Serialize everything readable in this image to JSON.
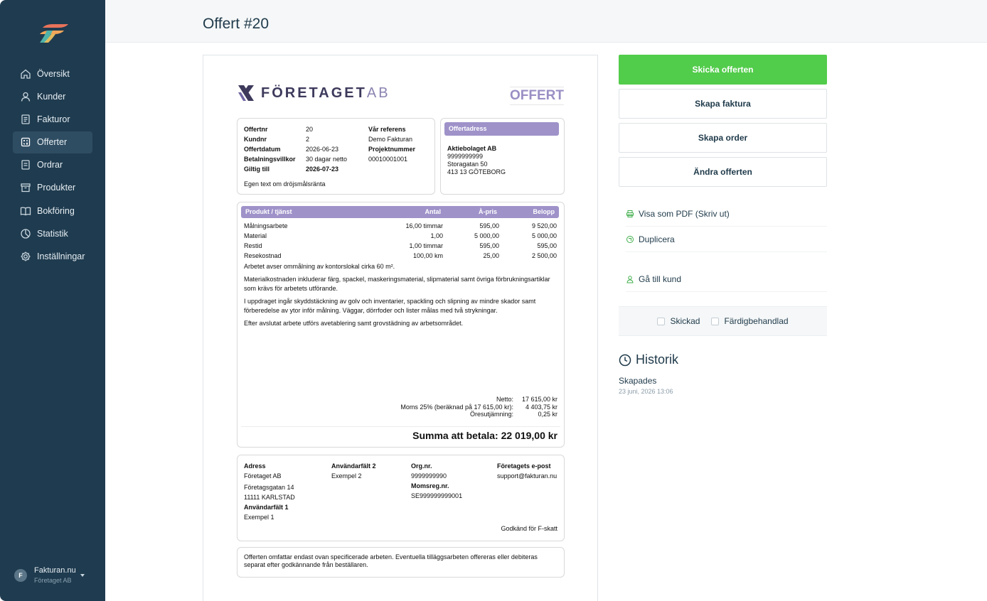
{
  "sidebar": {
    "items": [
      {
        "label": "Översikt",
        "icon": "home-icon"
      },
      {
        "label": "Kunder",
        "icon": "user-icon"
      },
      {
        "label": "Fakturor",
        "icon": "invoice-icon"
      },
      {
        "label": "Offerter",
        "icon": "calculator-icon",
        "active": true
      },
      {
        "label": "Ordrar",
        "icon": "order-icon"
      },
      {
        "label": "Produkter",
        "icon": "archive-box-icon"
      },
      {
        "label": "Bokföring",
        "icon": "book-icon"
      },
      {
        "label": "Statistik",
        "icon": "pie-chart-icon"
      },
      {
        "label": "Inställningar",
        "icon": "gear-icon"
      }
    ],
    "account": {
      "initial": "F",
      "name": "Fakturan.nu",
      "company": "Företaget AB"
    }
  },
  "header": {
    "title": "Offert #20"
  },
  "document": {
    "brand": {
      "name": "FÖRETAGET",
      "suffix": "AB"
    },
    "doc_type": "OFFERT",
    "info": {
      "rows": [
        [
          "Offertnr",
          "20",
          "Vår referens"
        ],
        [
          "Kundnr",
          "2",
          "Demo Fakturan"
        ],
        [
          "Offertdatum",
          "2026-06-23",
          "Projektnummer"
        ],
        [
          "Betalningsvillkor",
          "30 dagar netto",
          "00010001001"
        ],
        [
          "Giltig till",
          "2026-07-23",
          ""
        ]
      ],
      "custom_text": "Egen text om dröjsmålsränta"
    },
    "address": {
      "heading": "Offertadress",
      "company": "Aktiebolaget AB",
      "number": "9999999999",
      "street": "Storagatan 50",
      "city": "413 13 GÖTEBORG"
    },
    "lines": {
      "headers": {
        "product": "Produkt / tjänst",
        "qty": "Antal",
        "price": "À-pris",
        "amount": "Belopp"
      },
      "rows": [
        {
          "name": "Målningsarbete",
          "qty": "16,00 timmar",
          "price": "595,00",
          "amount": "9 520,00"
        },
        {
          "name": "Material",
          "qty": "1,00",
          "price": "5 000,00",
          "amount": "5 000,00"
        },
        {
          "name": "Restid",
          "qty": "1,00 timmar",
          "price": "595,00",
          "amount": "595,00"
        },
        {
          "name": "Resekostnad",
          "qty": "100,00 km",
          "price": "25,00",
          "amount": "2 500,00"
        }
      ],
      "paragraphs": [
        "Arbetet avser ommålning av kontorslokal cirka 60 m².",
        "Materialkostnaden inkluderar färg, spackel, maskeringsmaterial, slipmaterial samt övriga förbrukningsartiklar som krävs för arbetets utförande.",
        "I uppdraget ingår skyddstäckning av golv och inventarier, spackling och slipning av mindre skador samt förberedelse av ytor inför målning. Väggar, dörrfoder och lister målas med två strykningar.",
        "Efter avslutat arbete utförs avetablering samt grovstädning av arbetsområdet."
      ],
      "totals": [
        {
          "label": "Netto:",
          "value": "17 615,00 kr"
        },
        {
          "label": "Moms 25% (beräknad på 17 615,00 kr):",
          "value": "4 403,75 kr"
        },
        {
          "label": "Öresutjämning:",
          "value": "0,25 kr"
        }
      ],
      "sum_label": "Summa att betala: 22 019,00 kr"
    },
    "footer": {
      "col1": {
        "h": "Adress",
        "l1": "Företaget AB",
        "l2": "Företagsgatan 14",
        "l3": "11111 KARLSTAD",
        "h2": "Användarfält 1",
        "l4": "Exempel 1"
      },
      "col2": {
        "h": "Användarfält 2",
        "l1": "Exempel 2"
      },
      "col3": {
        "h": "Org.nr.",
        "l1": "9999999990",
        "h2": "Momsreg.nr.",
        "l2": "SE999999999001"
      },
      "col4": {
        "h": "Företagets e-post",
        "l1": "support@fakturan.nu"
      },
      "fskatt": "Godkänd för F-skatt"
    },
    "note": "Offerten omfattar endast ovan specificerade arbeten. Eventuella tilläggsarbeten offereras eller debiteras separat efter godkännande från beställaren."
  },
  "actions": {
    "send": "Skicka offerten",
    "create_invoice": "Skapa faktura",
    "create_order": "Skapa order",
    "edit": "Ändra offerten",
    "view_pdf": "Visa som PDF (Skriv ut)",
    "duplicate": "Duplicera",
    "go_to_customer": "Gå till kund",
    "sent_label": "Skickad",
    "done_label": "Färdigbehandlad"
  },
  "history": {
    "title": "Historik",
    "events": [
      {
        "label": "Skapades",
        "time": "23 juni, 2026 13:06"
      }
    ]
  },
  "colors": {
    "sidebar": "#1f3b4f",
    "primary_button": "#52cc4b",
    "accent_purple": "#9f92c9",
    "text": "#1f3a4a"
  }
}
